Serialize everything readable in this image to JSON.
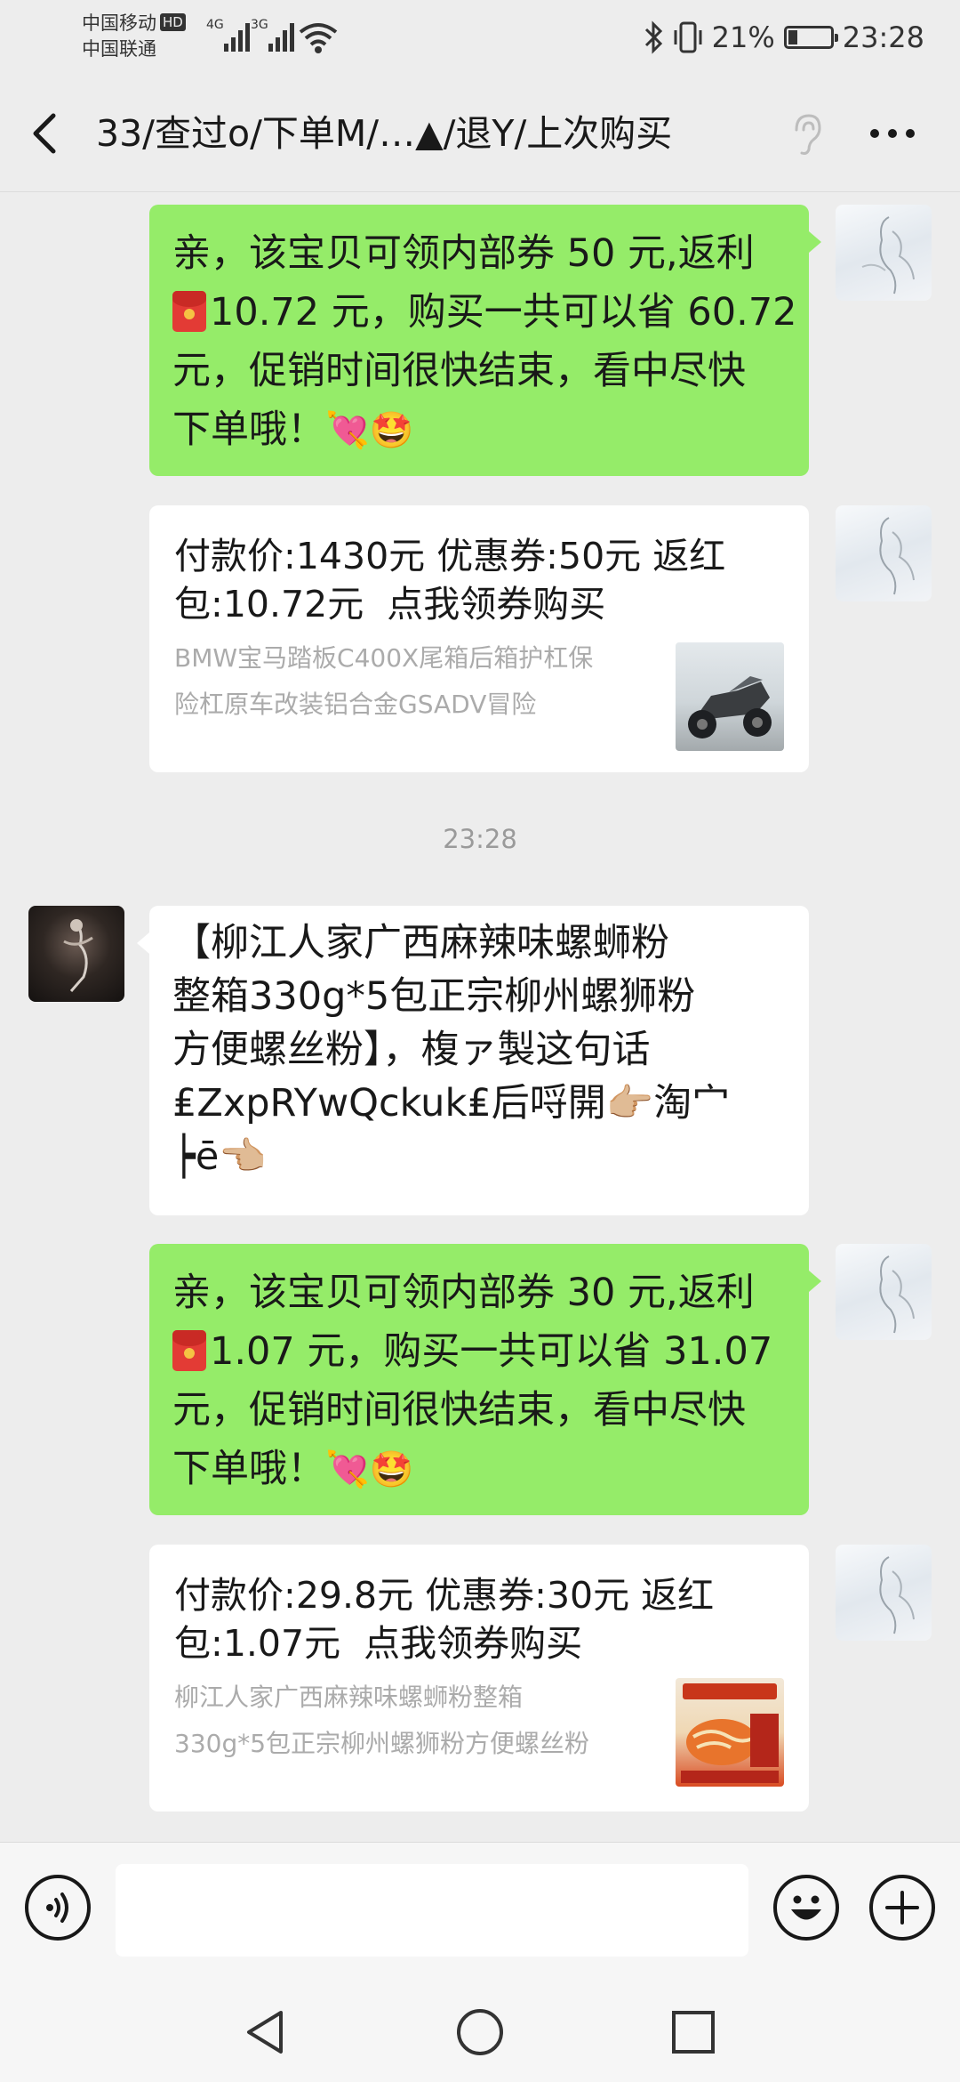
{
  "status_bar": {
    "carrier_1": "中国移动",
    "carrier_1_badge": "HD",
    "carrier_2": "中国联通",
    "signal_1": "4G",
    "signal_2": "3G",
    "battery_percent": "21%",
    "battery_level": 0.21,
    "time": "23:28"
  },
  "header": {
    "title": "33/查过o/下单M/…▲/退Y/上次购买"
  },
  "messages": [
    {
      "type": "promo",
      "line1": "亲，该宝贝可领内部券 50 元,返利",
      "line2": "10.72 元，购买一共可以省 60.72",
      "line3": "元，促销时间很快结束，看中尽快",
      "line4": "下单哦！",
      "emoji": "💘🤩"
    },
    {
      "type": "card",
      "title_line1": "付款价:1430元 优惠券:50元 返红",
      "title_line2": "包:10.72元",
      "action": "点我领券购买",
      "desc_line1": "BMW宝马踏板C400X尾箱后箱护杠保",
      "desc_line2": "险杠原车改装铝合金GSADV冒险"
    },
    {
      "type": "timestamp",
      "text": "23:28"
    },
    {
      "type": "text",
      "line1": "【柳江人家广西麻辣味螺蛳粉",
      "line2": "整箱330g*5包正宗柳州螺狮粉",
      "line3": "方便螺丝粉】，椱ァ製这句话",
      "line4": "₤ZxpRYwQckuk₤后哷開👉🏼淘宀",
      "line5": "┝ē👈🏼"
    },
    {
      "type": "promo",
      "line1": "亲，该宝贝可领内部券 30 元,返利",
      "line2": "1.07 元，购买一共可以省 31.07",
      "line3": "元，促销时间很快结束，看中尽快",
      "line4": "下单哦！",
      "emoji": "💘🤩"
    },
    {
      "type": "card",
      "title_line1": "付款价:29.8元 优惠券:30元 返红",
      "title_line2": "包:1.07元",
      "action": "点我领券购买",
      "desc_line1": "柳江人家广西麻辣味螺蛳粉整箱",
      "desc_line2": "330g*5包正宗柳州螺狮粉方便螺丝粉"
    }
  ],
  "input_bar": {
    "voice_icon": "voice-icon",
    "emoji_icon": "emoji-icon",
    "plus_icon": "plus-icon"
  },
  "colors": {
    "sent_bubble": "#95ec69",
    "received_bubble": "#ffffff",
    "background": "#ededed"
  }
}
